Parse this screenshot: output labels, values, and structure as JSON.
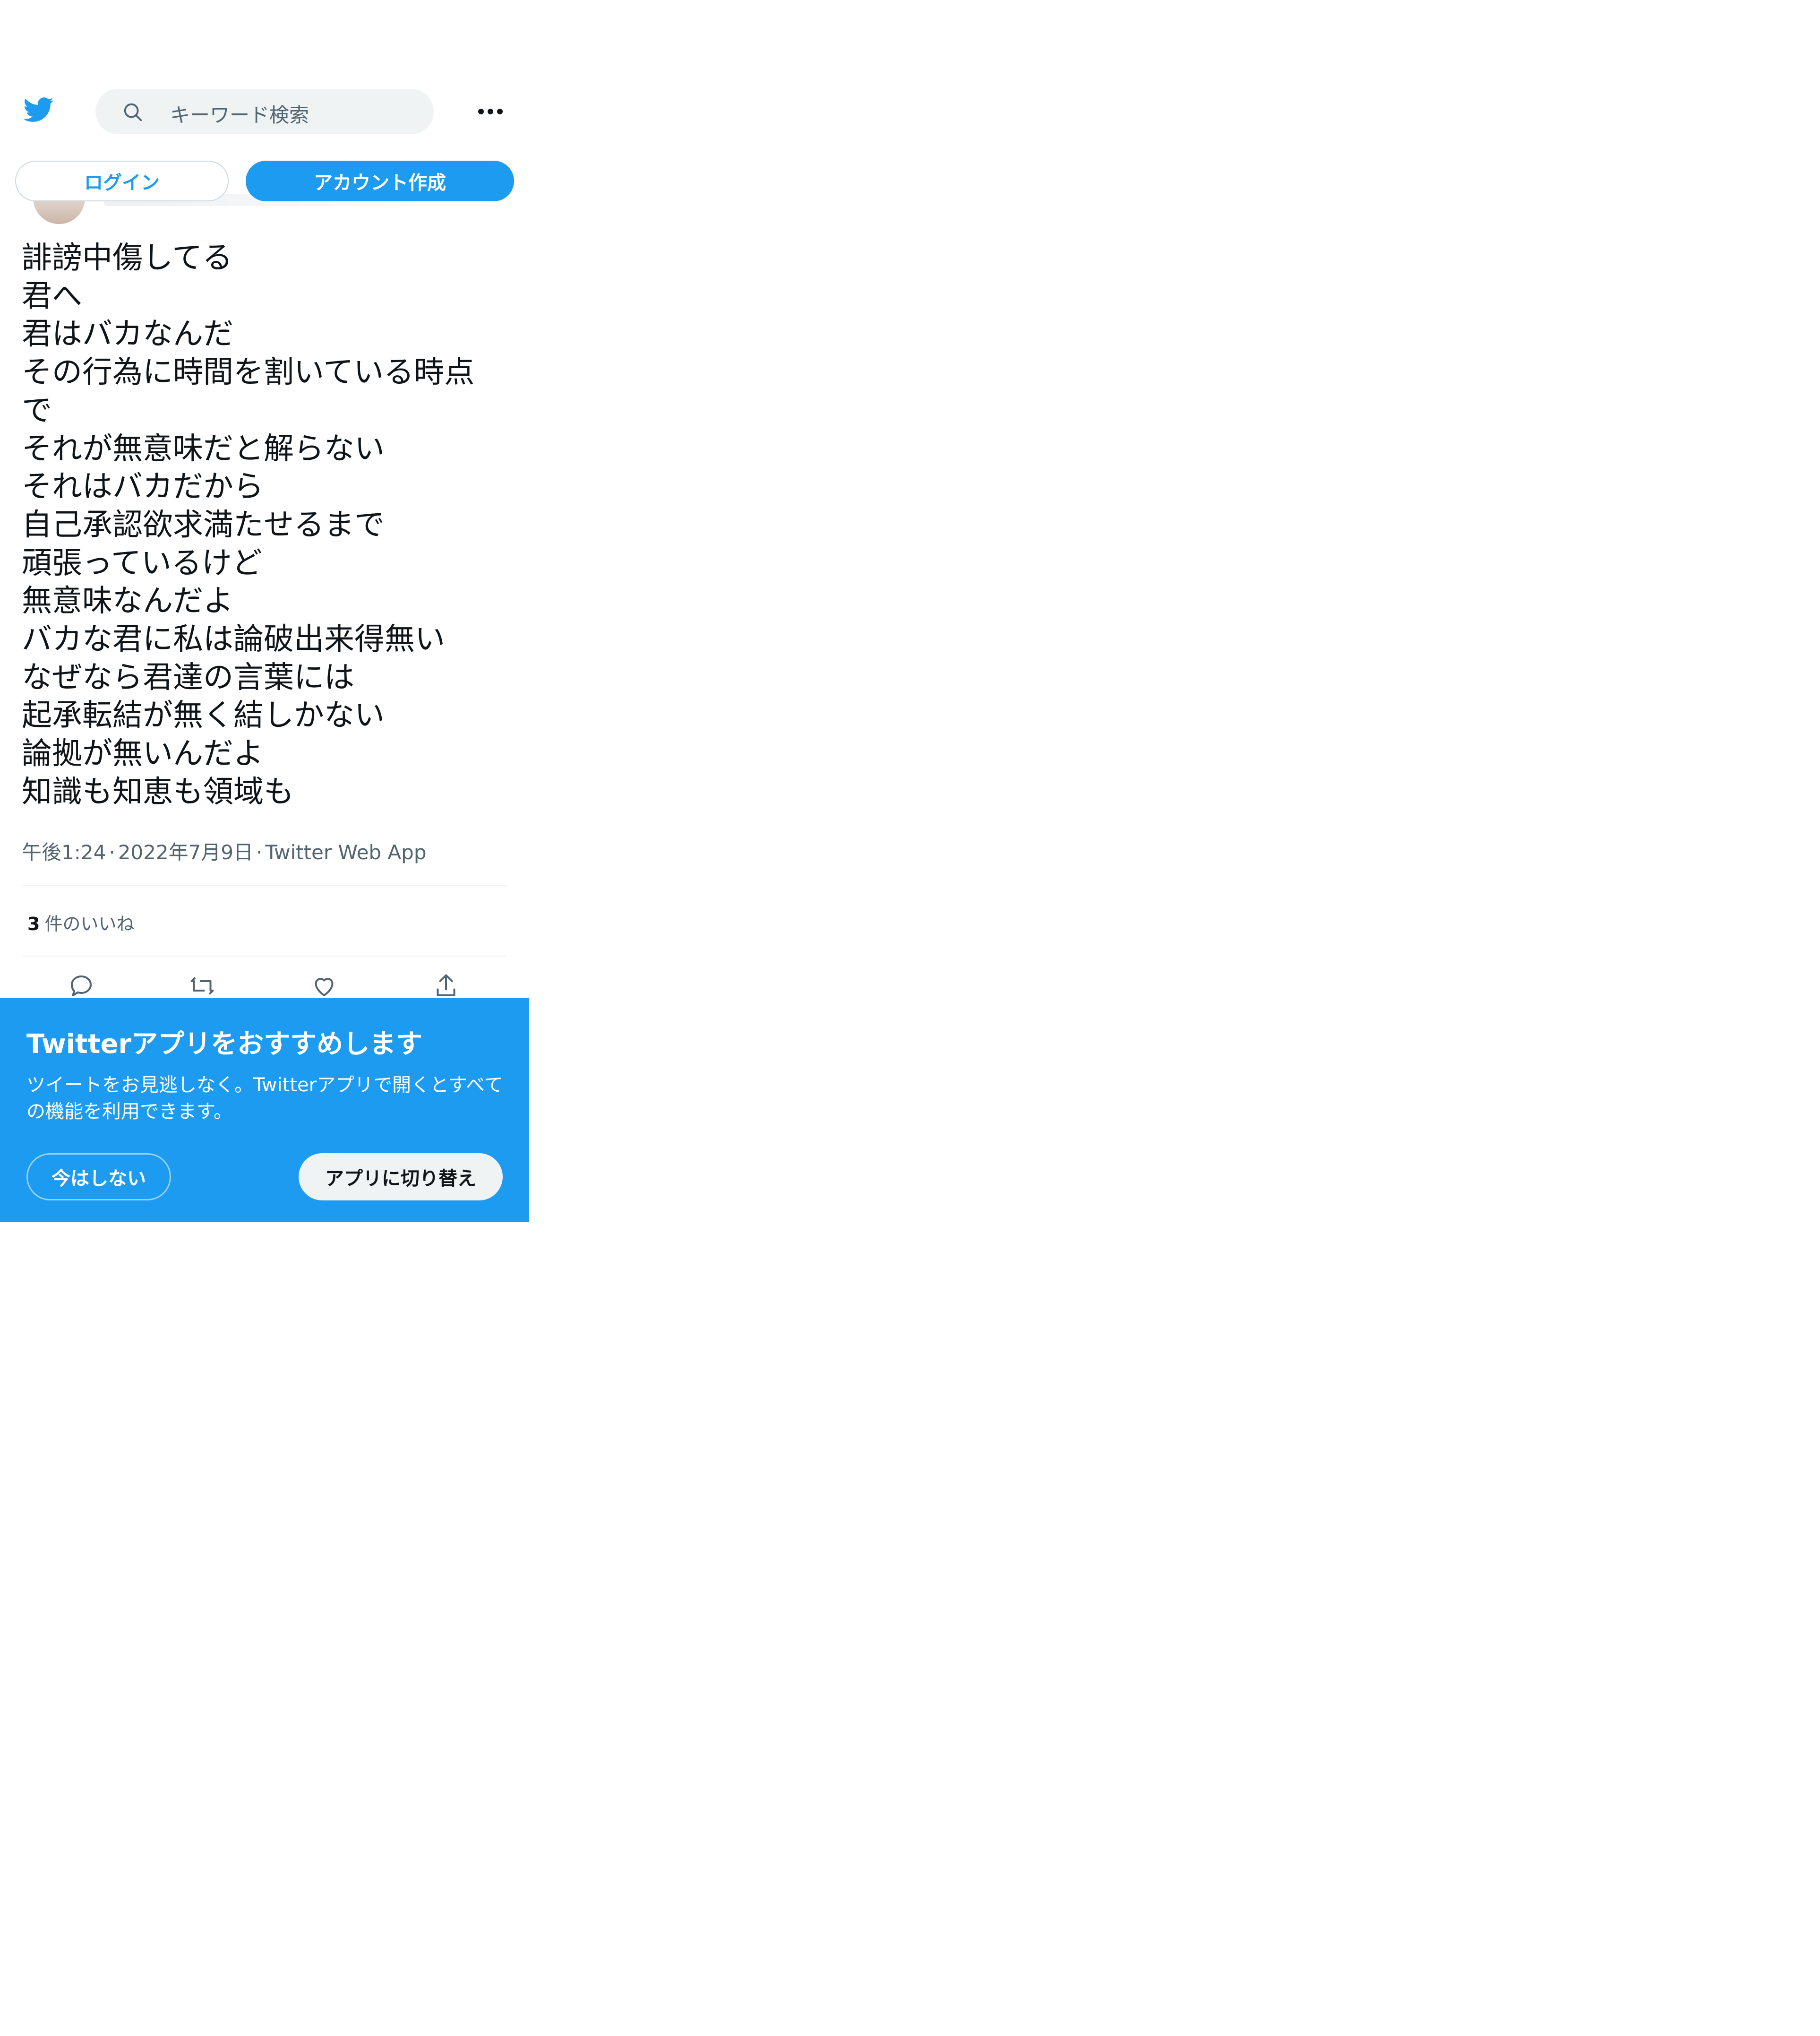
{
  "header": {
    "logo_icon": "twitter-bird-icon",
    "search_icon": "search-icon",
    "search_placeholder": "キーワード検索",
    "more_icon": "more-horizontal-icon"
  },
  "auth": {
    "login_label": "ログイン",
    "signup_label": "アカウント作成"
  },
  "tweet": {
    "lines": [
      "誹謗中傷してる",
      "君へ",
      "君はバカなんだ",
      "その行為に時間を割いている時点",
      "で",
      "それが無意味だと解らない",
      "それはバカだから",
      "自己承認欲求満たせるまで",
      "頑張っているけど",
      "無意味なんだよ",
      "バカな君に私は論破出来得無い",
      "なぜなら君達の言葉には",
      "起承転結が無く結しかない",
      "論拠が無いんだよ",
      "知識も知恵も領域も"
    ],
    "time": "午後1:24",
    "date": "2022年7月9日",
    "source": "Twitter Web App",
    "separator": "·",
    "likes_count": "3",
    "likes_label": "件のいいね"
  },
  "actions": {
    "reply_icon": "reply-icon",
    "retweet_icon": "retweet-icon",
    "like_icon": "heart-icon",
    "share_icon": "share-icon"
  },
  "promo": {
    "title": "Twitterアプリをおすすめします",
    "body": "ツイートをお見逃しなく。Twitterアプリで開くとすべての機能を利用できます。",
    "dismiss_label": "今はしない",
    "switch_label": "アプリに切り替え"
  },
  "colors": {
    "brand": "#1d9bf0",
    "text": "#0f1419",
    "muted": "#536471",
    "search_bg": "#eff3f4"
  }
}
